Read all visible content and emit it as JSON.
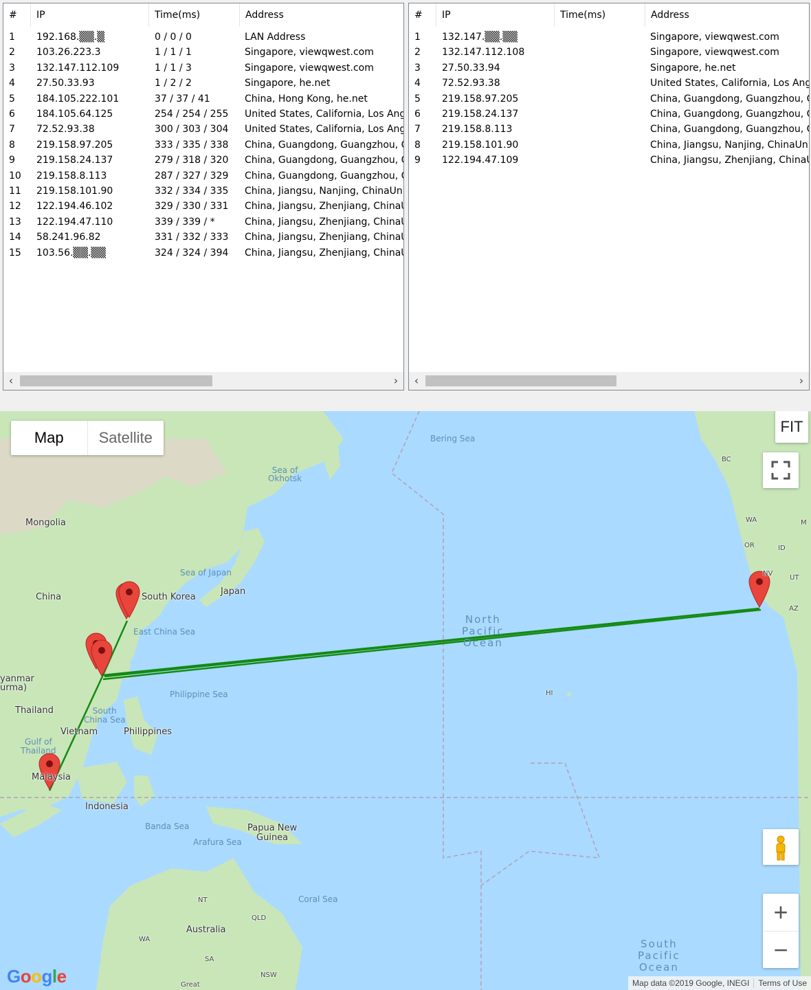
{
  "left_table": {
    "headers": [
      "#",
      "IP",
      "Time(ms)",
      "Address"
    ],
    "rows": [
      [
        "1",
        "192.168.▒▒.▒",
        "0 / 0 / 0",
        "LAN Address"
      ],
      [
        "2",
        "103.26.223.3",
        "1 / 1 / 1",
        "Singapore, viewqwest.com"
      ],
      [
        "3",
        "132.147.112.109",
        "1 / 1 / 3",
        "Singapore, viewqwest.com"
      ],
      [
        "4",
        "27.50.33.93",
        "1 / 2 / 2",
        "Singapore, he.net"
      ],
      [
        "5",
        "184.105.222.101",
        "37 / 37 / 41",
        "China, Hong Kong, he.net"
      ],
      [
        "6",
        "184.105.64.125",
        "254 / 254 / 255",
        "United States, California, Los Angele"
      ],
      [
        "7",
        "72.52.93.38",
        "300 / 303 / 304",
        "United States, California, Los Angele"
      ],
      [
        "8",
        "219.158.97.205",
        "333 / 335 / 338",
        "China, Guangdong, Guangzhou, Chi"
      ],
      [
        "9",
        "219.158.24.137",
        "279 / 318 / 320",
        "China, Guangdong, Guangzhou, Chi"
      ],
      [
        "10",
        "219.158.8.113",
        "287 / 327 / 329",
        "China, Guangdong, Guangzhou, Chi"
      ],
      [
        "11",
        "219.158.101.90",
        "332 / 334 / 335",
        "China, Jiangsu, Nanjing, ChinaUnico"
      ],
      [
        "12",
        "122.194.46.102",
        "329 / 330 / 331",
        "China, Jiangsu, Zhenjiang, ChinaUni"
      ],
      [
        "13",
        "122.194.47.110",
        "339 / 339 / *",
        "China, Jiangsu, Zhenjiang, ChinaUni"
      ],
      [
        "14",
        "58.241.96.82",
        "331 / 332 / 333",
        "China, Jiangsu, Zhenjiang, ChinaUni"
      ],
      [
        "15",
        "103.56.▒▒.▒▒",
        "324 / 324 / 394",
        "China, Jiangsu, Zhenjiang, ChinaUni"
      ]
    ]
  },
  "right_table": {
    "headers": [
      "#",
      "IP",
      "Time(ms)",
      "Address"
    ],
    "rows": [
      [
        "1",
        "132.147.▒▒.▒▒",
        "",
        "Singapore, viewqwest.com"
      ],
      [
        "2",
        "132.147.112.108",
        "",
        "Singapore, viewqwest.com"
      ],
      [
        "3",
        "27.50.33.94",
        "",
        "Singapore, he.net"
      ],
      [
        "4",
        "72.52.93.38",
        "",
        "United States, California, Los Angele"
      ],
      [
        "5",
        "219.158.97.205",
        "",
        "China, Guangdong, Guangzhou, Chi"
      ],
      [
        "6",
        "219.158.24.137",
        "",
        "China, Guangdong, Guangzhou, Chi"
      ],
      [
        "7",
        "219.158.8.113",
        "",
        "China, Guangdong, Guangzhou, Chi"
      ],
      [
        "8",
        "219.158.101.90",
        "",
        "China, Jiangsu, Nanjing, ChinaUnico"
      ],
      [
        "9",
        "122.194.47.109",
        "",
        "China, Jiangsu, Zhenjiang, ChinaUni"
      ]
    ]
  },
  "scroll": {
    "left": "‹",
    "right": "›"
  },
  "map": {
    "type_map": "Map",
    "type_satellite": "Satellite",
    "fit_label": "FIT",
    "zoom_in": "+",
    "zoom_out": "−",
    "attribution": "Map data ©2019 Google, INEGI",
    "terms": "Terms of Use",
    "logo": "Google",
    "route_color": "#138a13",
    "marker_color": "#e8453c",
    "labels": {
      "mongolia": "Mongolia",
      "china": "China",
      "south_korea": "South Korea",
      "japan": "Japan",
      "myanmar": "yanmar\nurma)",
      "thailand": "Thailand",
      "vietnam": "Vietnam",
      "philippines": "Philippines",
      "malaysia": "Malaysia",
      "indonesia": "Indonesia",
      "png": "Papua New\nGuinea",
      "australia": "Australia",
      "sea_okhotsk": "Sea of\nOkhotsk",
      "bering": "Bering Sea",
      "sea_japan": "Sea of Japan",
      "east_china": "East China Sea",
      "philippine_sea": "Philippine Sea",
      "south_china": "South\nChina Sea",
      "gulf_thailand": "Gulf of\nThailand",
      "banda": "Banda Sea",
      "arafura": "Arafura Sea",
      "coral": "Coral Sea",
      "north_pacific": "North\nPacific\nOcean",
      "south_pacific": "South\nPacific\nOcean",
      "hi": "HI",
      "bc": "BC",
      "wa_us": "WA",
      "or": "OR",
      "id": "ID",
      "nv": "NV",
      "ut": "UT",
      "az": "AZ",
      "m": "M",
      "nt": "NT",
      "qld": "QLD",
      "wa_au": "WA",
      "sa": "SA",
      "nsw": "NSW",
      "great": "Great"
    }
  }
}
